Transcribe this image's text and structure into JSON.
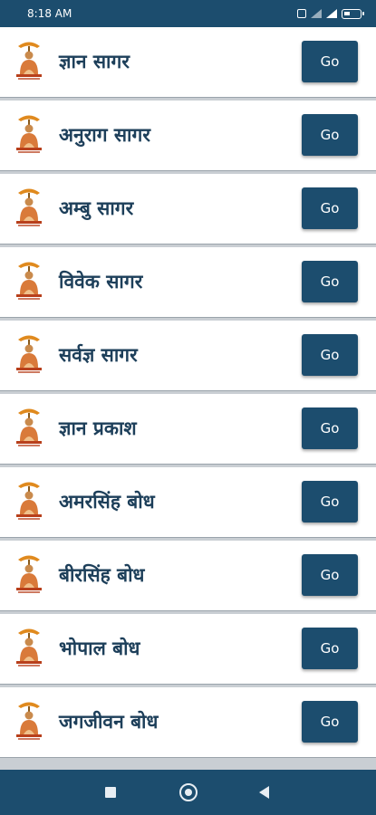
{
  "status_bar": {
    "time": "8:18 AM"
  },
  "items": [
    {
      "title": "ज्ञान सागर",
      "button": "Go"
    },
    {
      "title": "अनुराग सागर",
      "button": "Go"
    },
    {
      "title": "अम्बु सागर",
      "button": "Go"
    },
    {
      "title": "विवेक सागर",
      "button": "Go"
    },
    {
      "title": "सर्वज्ञ सागर",
      "button": "Go"
    },
    {
      "title": "ज्ञान प्रकाश",
      "button": "Go"
    },
    {
      "title": "अमरसिंह बोध",
      "button": "Go"
    },
    {
      "title": "बीरसिंह बोध",
      "button": "Go"
    },
    {
      "title": "भोपाल बोध",
      "button": "Go"
    },
    {
      "title": "जगजीवन बोध",
      "button": "Go"
    }
  ],
  "colors": {
    "primary": "#1c4d6e",
    "title_text": "#1d3f5a",
    "divider": "#c9ced3"
  },
  "icons": {
    "logo": "saint-logo-icon",
    "nav_recents": "square-icon",
    "nav_home": "circle-icon",
    "nav_back": "triangle-back-icon"
  }
}
